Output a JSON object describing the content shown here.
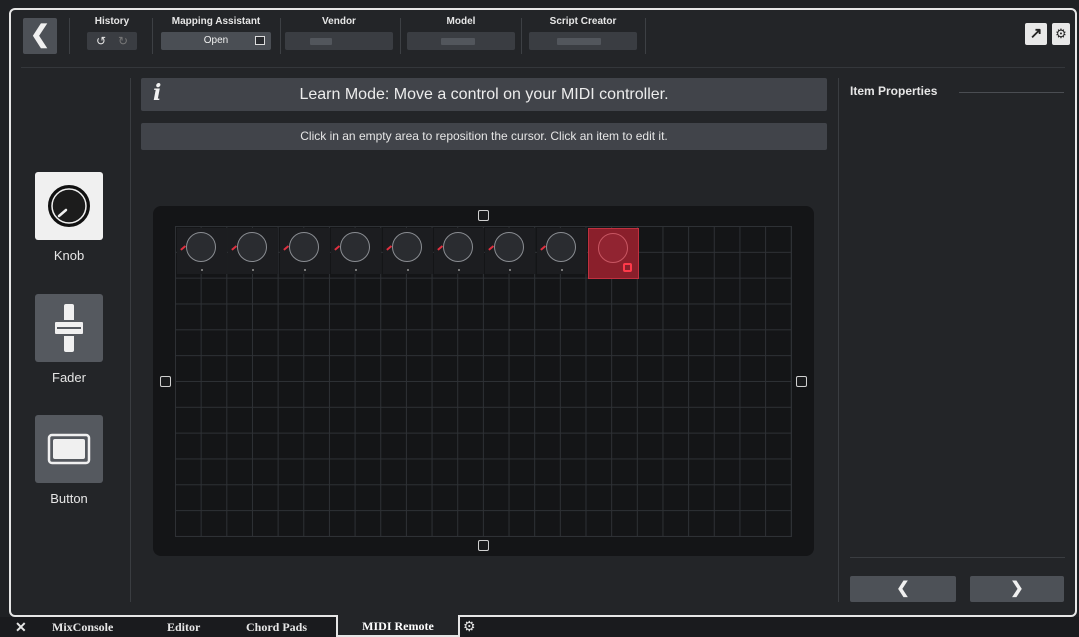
{
  "toolbar": {
    "back_icon": "chevron-left-icon",
    "history_label": "History",
    "undo_icon": "↺",
    "redo_icon": "↻",
    "mapping_label": "Mapping Assistant",
    "mapping_button": "Open",
    "vendor_label": "Vendor",
    "model_label": "Model",
    "script_label": "Script Creator",
    "external_icon": "↗",
    "settings_icon": "⚙"
  },
  "palette": {
    "items": [
      {
        "label": "Knob",
        "icon": "knob-icon",
        "selected": true
      },
      {
        "label": "Fader",
        "icon": "fader-icon",
        "selected": false
      },
      {
        "label": "Button",
        "icon": "button-icon",
        "selected": false
      }
    ]
  },
  "main": {
    "info_icon": "i",
    "learn_text": "Learn Mode: Move a control on your MIDI controller.",
    "hint_text": "Click in an empty area to reposition the cursor. Click an item to edit it.",
    "knob_count": 9,
    "selected_knob_index": 8
  },
  "properties": {
    "title": "Item Properties",
    "prev_icon": "❮",
    "next_icon": "❯"
  },
  "tabs": {
    "close_icon": "✕",
    "items": [
      {
        "label": "MixConsole",
        "active": false
      },
      {
        "label": "Editor",
        "active": false
      },
      {
        "label": "Chord Pads",
        "active": false
      },
      {
        "label": "MIDI Remote",
        "active": true
      }
    ],
    "settings_icon": "⚙"
  },
  "colors": {
    "accent_selected": "#8a1f2b",
    "knob_tick": "#e03040",
    "background": "#232528"
  }
}
